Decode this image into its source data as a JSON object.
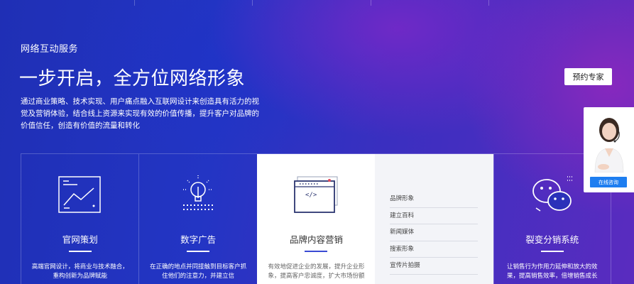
{
  "hero": {
    "label": "网络互动服务",
    "headline": "一步开启，全方位网络形象",
    "description": "通过商业策略、技术实现、用户痛点融入互联网设计来创造具有活力的视觉及营销体验，结合线上资源来实现有效的价值传播，提升客户对品牌的价值信任，创造有价值的流量和转化",
    "book_button": "预约专家"
  },
  "cards": [
    {
      "title": "官网策划",
      "text": "高端官网设计，将商业与技术融合，重构创新为品牌赋能",
      "icon": "chart-window-icon"
    },
    {
      "title": "数字广告",
      "text": "在正确的地点并同接触到目标客户抓住他们的注意力，并建立信",
      "icon": "lightbulb-icon"
    },
    {
      "title": "品牌内容营销",
      "text": "有效地促进企业的发展，提升企业形象，提高客户忠诚度，扩大市场份额",
      "icon": "code-window-icon"
    },
    {
      "title": "裂变分销系统",
      "text": "让销售行为作用力延伸和放大的效果，提高销售效率，倍增销售成长",
      "icon": "wechat-icon"
    }
  ],
  "submenu": [
    "品牌形象",
    "建立百科",
    "新闻媒体",
    "搜索形象",
    "宣传片拍摄"
  ],
  "chat": {
    "button": "在线咨询"
  },
  "colors": {
    "accent": "#3a4bd4",
    "chat_blue": "#1e7ef0"
  }
}
